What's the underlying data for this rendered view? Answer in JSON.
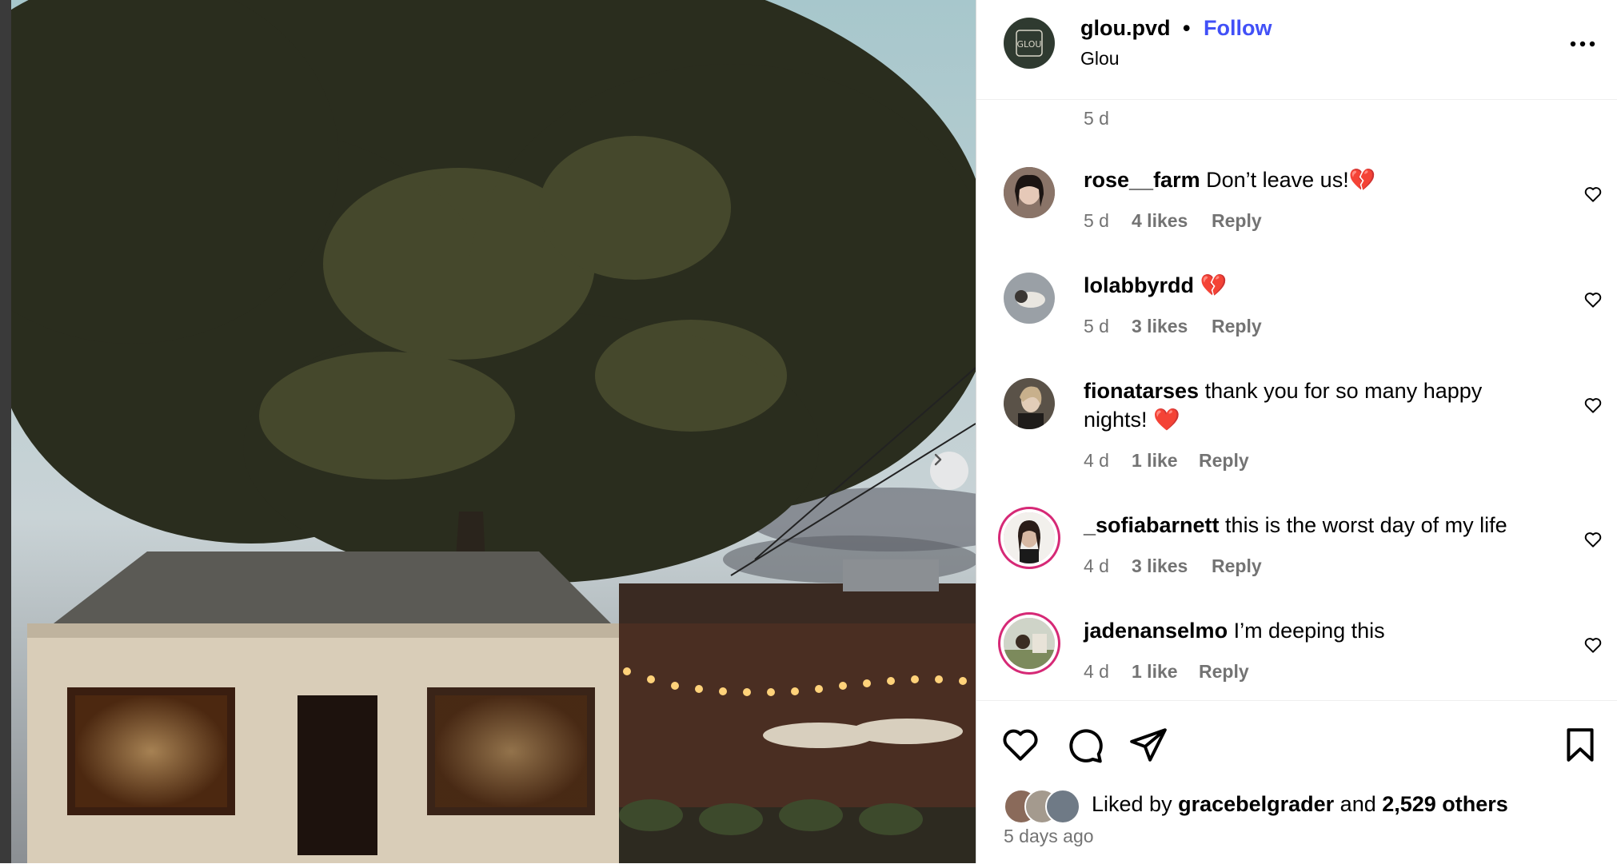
{
  "post": {
    "author": "glou.pvd",
    "separator": "•",
    "follow_label": "Follow",
    "subtitle": "Glou",
    "avatar_text": "GLOU"
  },
  "top_meta": "5 d",
  "comments": [
    {
      "user": "rose__farm",
      "text": " Don’t leave us!💔",
      "age": "5 d",
      "likes": "4 likes",
      "reply": "Reply"
    },
    {
      "user": "lolabbyrdd",
      "text": " 💔",
      "age": "5 d",
      "likes": "3 likes",
      "reply": "Reply"
    },
    {
      "user": "fionatarses",
      "text": " thank you for so many happy nights! ❤️",
      "age": "4 d",
      "likes": "1 like",
      "reply": "Reply"
    },
    {
      "user": "_sofiabarnett",
      "text": " this is the worst day of my life",
      "age": "4 d",
      "likes": "3 likes",
      "reply": "Reply"
    },
    {
      "user": "jadenanselmo",
      "text": " I’m deeping this",
      "age": "4 d",
      "likes": "1 like",
      "reply": "Reply"
    }
  ],
  "likes": {
    "prefix": "Liked by ",
    "user": "gracebelgrader",
    "middle": " and ",
    "others": "2,529 others"
  },
  "post_time": "5 days ago",
  "icons": [
    "more-icon",
    "heart-icon",
    "comment-icon",
    "share-icon",
    "bookmark-icon",
    "chevron-right-icon"
  ],
  "colors": {
    "link": "#4150f7",
    "meta": "#737373",
    "story_ring": "#d62976"
  }
}
